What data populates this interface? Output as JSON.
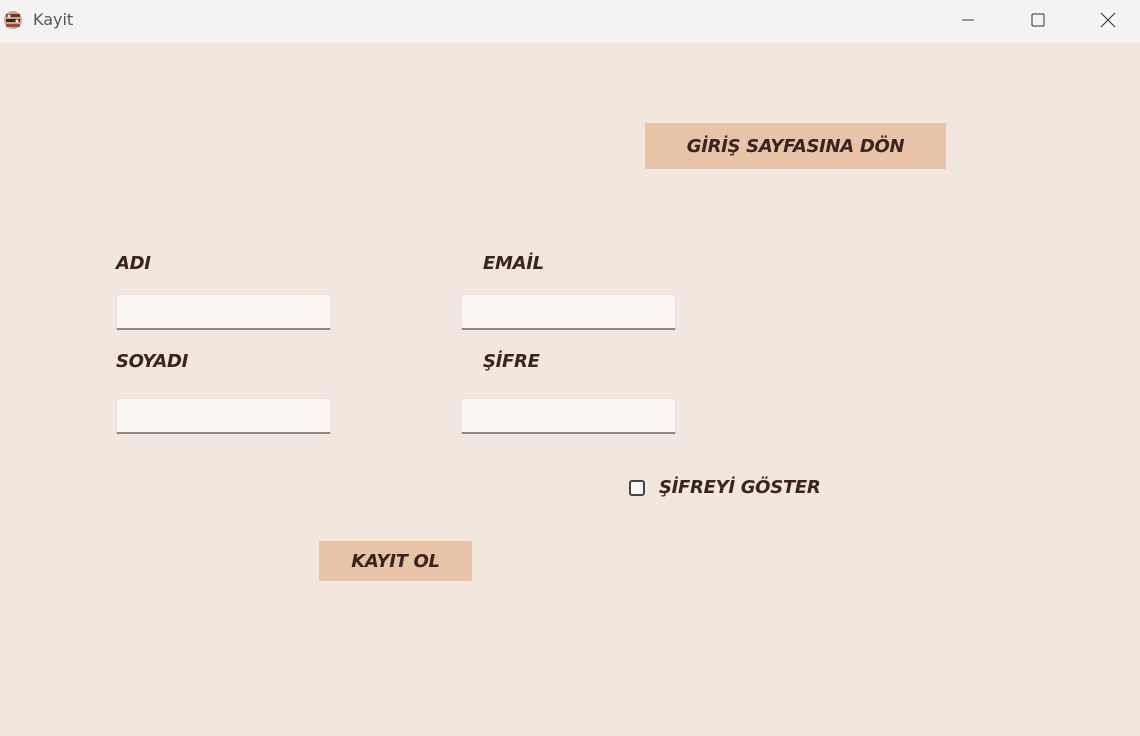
{
  "window": {
    "title": "Kayit",
    "icon": "app-icon"
  },
  "buttons": {
    "back_label": "GİRİŞ SAYFASINA DÖN",
    "register_label": "KAYIT OL"
  },
  "form": {
    "first_name": {
      "label": "ADI",
      "value": "",
      "placeholder": ""
    },
    "last_name": {
      "label": "SOYADI",
      "value": "",
      "placeholder": ""
    },
    "email": {
      "label": "EMAİL",
      "value": "",
      "placeholder": ""
    },
    "password": {
      "label": "ŞİFRE",
      "value": "",
      "placeholder": ""
    }
  },
  "show_password": {
    "label": "ŞİFREYİ GÖSTER",
    "checked": false
  },
  "colors": {
    "background": "#f2e7df",
    "button": "#e8c3a8",
    "text": "#3a2420",
    "input": "#faf5f1"
  }
}
